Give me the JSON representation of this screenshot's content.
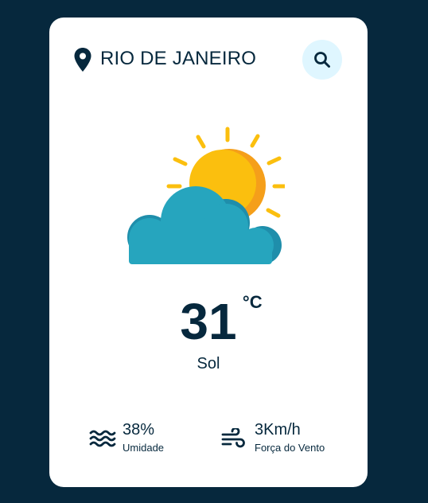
{
  "location": {
    "icon": "map-pin-icon",
    "city": "RIO DE JANEIRO"
  },
  "search": {
    "icon": "search-icon"
  },
  "weather": {
    "icon": "sun-behind-cloud-icon",
    "temperature": "31",
    "unit": "°C",
    "description": "Sol"
  },
  "details": {
    "humidity": {
      "icon": "humidity-waves-icon",
      "value": "38%",
      "label": "Umidade"
    },
    "wind": {
      "icon": "wind-icon",
      "value": "3Km/h",
      "label": "Força do Vento"
    }
  },
  "colors": {
    "background": "#06283d",
    "card": "#ffffff",
    "text": "#06283d",
    "search_button": "#dff6ff",
    "sun": "#fbbf0e",
    "cloud": "#26a5be"
  }
}
